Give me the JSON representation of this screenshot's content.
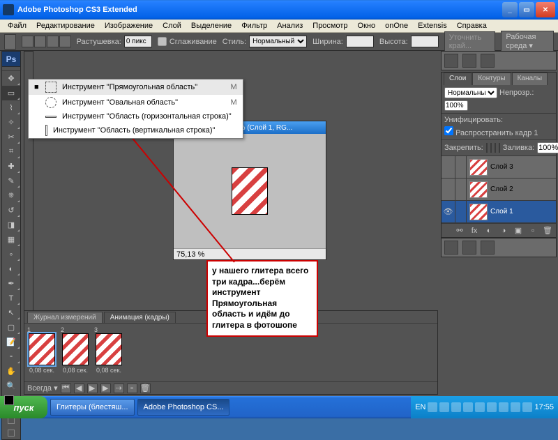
{
  "window": {
    "title": "Adobe Photoshop CS3 Extended"
  },
  "menu": [
    "Файл",
    "Редактирование",
    "Изображение",
    "Слой",
    "Выделение",
    "Фильтр",
    "Анализ",
    "Просмотр",
    "Окно",
    "onOne",
    "Extensis",
    "Справка"
  ],
  "opts": {
    "feather_label": "Растушевка:",
    "feather_val": "0 пикс",
    "antialias": "Сглаживание",
    "style_label": "Стиль:",
    "style_val": "Нормальный",
    "width_label": "Ширина:",
    "height_label": "Высота:",
    "refine": "Уточнить край...",
    "workspace": "Рабочая среда ▾"
  },
  "flyout": [
    {
      "label": "Инструмент \"Прямоугольная область\"",
      "key": "M",
      "sel": true,
      "shape": "rect"
    },
    {
      "label": "Инструмент \"Овальная область\"",
      "key": "M",
      "shape": "oval"
    },
    {
      "label": "Инструмент \"Область (горизонтальная строка)\"",
      "key": "",
      "shape": "row"
    },
    {
      "label": "Инструмент \"Область (вертикальная строка)\"",
      "key": "",
      "shape": "col"
    }
  ],
  "doc": {
    "title": "Безимени-3 @ 75,1% (Слой 1, RG...",
    "zoom": "75,13 %"
  },
  "annot": "у нашего глитера всего три кадра...берём инструмент Прямоугольная область и идём до глитера в фотошопе",
  "bottom_tabs": [
    "Журнал измерений",
    "Анимация (кадры)"
  ],
  "frames": [
    {
      "n": "1",
      "t": "0,08 сек."
    },
    {
      "n": "2",
      "t": "0,08 сек."
    },
    {
      "n": "3",
      "t": "0,08 сек."
    }
  ],
  "anim_loop": "Всегда ▾",
  "layers": {
    "tabs": [
      "Слои",
      "Контуры",
      "Каналы"
    ],
    "mode": "Нормальный",
    "opacity_label": "Непрозр.:",
    "opacity": "100%",
    "unify": "Унифицировать:",
    "propagate": "Распространить кадр 1",
    "lock_label": "Закрепить:",
    "fill_label": "Заливка:",
    "fill": "100%",
    "items": [
      {
        "name": "Слой 3"
      },
      {
        "name": "Слой 2"
      },
      {
        "name": "Слой 1",
        "sel": true,
        "eye": true
      }
    ]
  },
  "taskbar": {
    "start": "пуск",
    "tasks": [
      {
        "label": "Глитеры (блестяш..."
      },
      {
        "label": "Adobe Photoshop CS...",
        "active": true
      }
    ],
    "lang": "EN",
    "time": "17:55"
  }
}
